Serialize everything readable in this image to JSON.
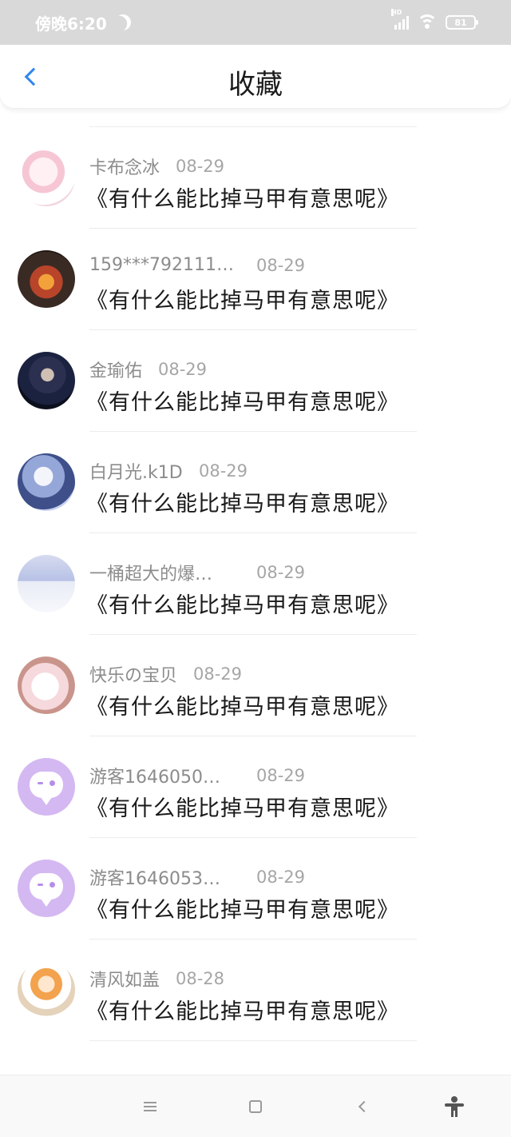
{
  "status_bar": {
    "time": "傍晚6:20",
    "battery": "81",
    "network": "HD"
  },
  "header": {
    "title": "收藏",
    "back_icon": "chevron-left-icon"
  },
  "favorites": [
    {
      "name": "",
      "date": "",
      "title": "《有什么能比掉马甲有意思呢》",
      "avatar": "default"
    },
    {
      "name": "卡布念冰",
      "date": "08-29",
      "title": "《有什么能比掉马甲有意思呢》",
      "avatar": "anime"
    },
    {
      "name": "159***792111…",
      "date": "08-29",
      "title": "《有什么能比掉马甲有意思呢》",
      "avatar": "fire"
    },
    {
      "name": "金瑜佑",
      "date": "08-29",
      "title": "《有什么能比掉马甲有意思呢》",
      "avatar": "dark"
    },
    {
      "name": "白月光.k1D",
      "date": "08-29",
      "title": "《有什么能比掉马甲有意思呢》",
      "avatar": "blue"
    },
    {
      "name": "一桶超大的爆…",
      "date": "08-29",
      "title": "《有什么能比掉马甲有意思呢》",
      "avatar": "group"
    },
    {
      "name": "快乐の宝贝",
      "date": "08-29",
      "title": "《有什么能比掉马甲有意思呢》",
      "avatar": "bear"
    },
    {
      "name": "游客1646050…",
      "date": "08-29",
      "title": "《有什么能比掉马甲有意思呢》",
      "avatar": "default"
    },
    {
      "name": "游客1646053…",
      "date": "08-29",
      "title": "《有什么能比掉马甲有意思呢》",
      "avatar": "default"
    },
    {
      "name": "清风如盖",
      "date": "08-28",
      "title": "《有什么能比掉马甲有意思呢》",
      "avatar": "chibi"
    }
  ],
  "nav_bar": {
    "menu_icon": "menu-icon",
    "home_icon": "home-icon",
    "back_icon": "back-icon",
    "accessibility_icon": "accessibility-icon"
  },
  "colors": {
    "accent": "#2f86f0",
    "default_avatar": "#d4b8f2",
    "status_bar": "#d9d9d9"
  }
}
